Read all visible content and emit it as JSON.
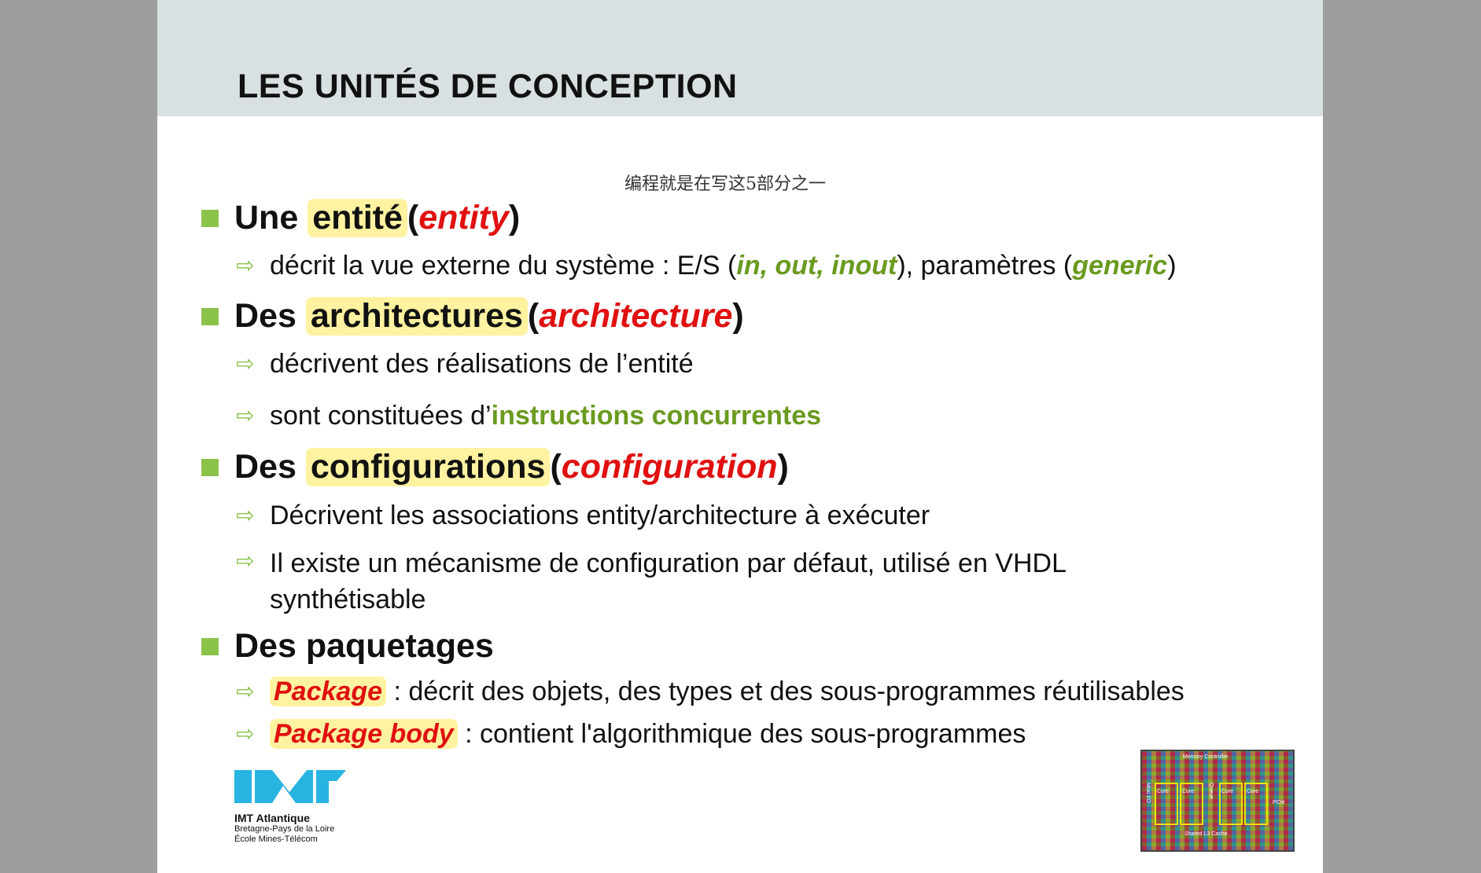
{
  "slide": {
    "title": "LES UNITÉS DE CONCEPTION",
    "note": "编程就是在写这5部分之一",
    "entity": {
      "prefix": "Une ",
      "term": "entité",
      "open": " (",
      "keyword": "entity",
      "close": ")",
      "desc_pre": "décrit la vue externe du système : E/S (",
      "desc_kw1": "in, out, inout",
      "desc_mid": "), paramètres (",
      "desc_kw2": "generic",
      "desc_post": ")"
    },
    "architecture": {
      "prefix": "Des ",
      "term": "architectures",
      "open": " (",
      "keyword": "architecture",
      "close": ")",
      "desc1": "décrivent des réalisations de l’entité",
      "desc2_pre": "sont constituées d’",
      "desc2_kw": "instructions concurrentes"
    },
    "configuration": {
      "prefix": "Des ",
      "term": "configurations",
      "open": " (",
      "keyword": "configuration",
      "close": ")",
      "desc1": "Décrivent les associations entity/architecture à exécuter",
      "desc2_line1": "Il existe un mécanisme de configuration par défaut, utilisé en VHDL",
      "desc2_line2": "synthétisable"
    },
    "package": {
      "heading": "Des paquetages",
      "item1_kw": "Package",
      "item1_text": " : décrit des objets, des types et des sous-programmes réutilisables",
      "item2_kw": "Package body",
      "item2_text": " : contient l'algorithmique des sous-programmes"
    }
  },
  "logo": {
    "name": "IMT Atlantique",
    "line2": "Bretagne-Pays de la Loire",
    "line3": "École Mines-Télécom"
  },
  "chip": {
    "memory_label": "Memory Controller",
    "core_label": "Core",
    "cache_label": "Shared L3 Cache",
    "misc_label": "Misc I/O",
    "queue_label": "Queue",
    "pci_label": "PCIe"
  },
  "colors": {
    "bullet": "#8bc34a",
    "keyword_red": "#e01010",
    "keyword_green": "#6a9a1f",
    "highlight": "#fff2a0",
    "header_bg": "#d9e0e2"
  }
}
